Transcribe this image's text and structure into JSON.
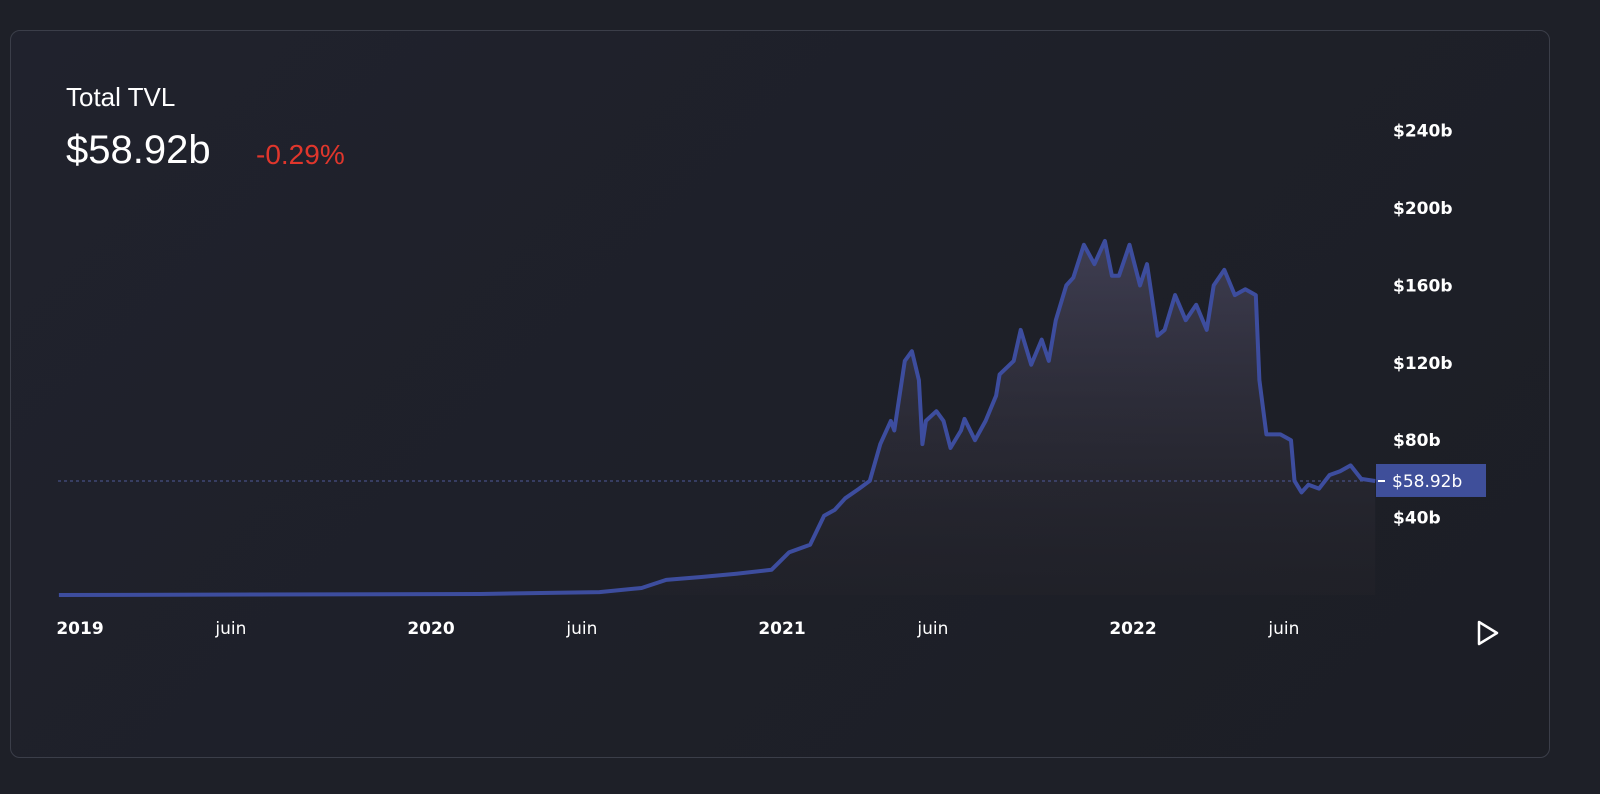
{
  "header": {
    "title": "Total TVL",
    "value": "$58.92b",
    "change": "-0.29%"
  },
  "colors": {
    "line": "#3d4d9e",
    "change_negative": "#e0362c",
    "current_label_bg": "#3f4f9a"
  },
  "play_icon": "play-icon",
  "chart_data": {
    "type": "area",
    "title": "Total TVL",
    "xlabel": "",
    "ylabel": "",
    "x_unit": "decimal year",
    "y_unit": "billion USD",
    "ylim": [
      0,
      240
    ],
    "xlim": [
      2018.94,
      2022.69
    ],
    "y_ticks": [
      {
        "value": 40,
        "label": "$40b"
      },
      {
        "value": 80,
        "label": "$80b"
      },
      {
        "value": 120,
        "label": "$120b"
      },
      {
        "value": 160,
        "label": "$160b"
      },
      {
        "value": 200,
        "label": "$200b"
      },
      {
        "value": 240,
        "label": "$240b"
      }
    ],
    "x_ticks": [
      {
        "value": 2019.0,
        "label": "2019",
        "year": true
      },
      {
        "value": 2019.43,
        "label": "juin",
        "year": false
      },
      {
        "value": 2020.0,
        "label": "2020",
        "year": true
      },
      {
        "value": 2020.43,
        "label": "juin",
        "year": false
      },
      {
        "value": 2021.0,
        "label": "2021",
        "year": true
      },
      {
        "value": 2021.43,
        "label": "juin",
        "year": false
      },
      {
        "value": 2022.0,
        "label": "2022",
        "year": true
      },
      {
        "value": 2022.43,
        "label": "juin",
        "year": false
      }
    ],
    "current": {
      "value": 58.92,
      "label": "$58.92b"
    },
    "grid": false,
    "series": [
      {
        "name": "Total TVL",
        "points": [
          [
            2018.94,
            0
          ],
          [
            2020.14,
            0.5
          ],
          [
            2020.48,
            1.5
          ],
          [
            2020.6,
            3.6
          ],
          [
            2020.67,
            7.8
          ],
          [
            2020.77,
            9.3
          ],
          [
            2020.87,
            11
          ],
          [
            2020.97,
            13
          ],
          [
            2021.02,
            22
          ],
          [
            2021.08,
            26
          ],
          [
            2021.12,
            41
          ],
          [
            2021.15,
            44
          ],
          [
            2021.18,
            50
          ],
          [
            2021.22,
            55
          ],
          [
            2021.25,
            59
          ],
          [
            2021.28,
            78
          ],
          [
            2021.31,
            90
          ],
          [
            2021.32,
            85
          ],
          [
            2021.35,
            121
          ],
          [
            2021.37,
            126
          ],
          [
            2021.39,
            111
          ],
          [
            2021.4,
            78
          ],
          [
            2021.41,
            90
          ],
          [
            2021.44,
            95
          ],
          [
            2021.46,
            90
          ],
          [
            2021.48,
            76
          ],
          [
            2021.51,
            85
          ],
          [
            2021.52,
            91
          ],
          [
            2021.55,
            80
          ],
          [
            2021.58,
            90
          ],
          [
            2021.61,
            103
          ],
          [
            2021.62,
            114
          ],
          [
            2021.66,
            121
          ],
          [
            2021.68,
            137
          ],
          [
            2021.71,
            119
          ],
          [
            2021.74,
            132
          ],
          [
            2021.76,
            121
          ],
          [
            2021.78,
            142
          ],
          [
            2021.81,
            160
          ],
          [
            2021.83,
            164
          ],
          [
            2021.86,
            181
          ],
          [
            2021.89,
            171
          ],
          [
            2021.92,
            183
          ],
          [
            2021.94,
            165
          ],
          [
            2021.96,
            165
          ],
          [
            2021.99,
            181
          ],
          [
            2022.02,
            160
          ],
          [
            2022.04,
            171
          ],
          [
            2022.07,
            134
          ],
          [
            2022.09,
            137
          ],
          [
            2022.12,
            155
          ],
          [
            2022.15,
            142
          ],
          [
            2022.18,
            150
          ],
          [
            2022.21,
            137
          ],
          [
            2022.23,
            160
          ],
          [
            2022.26,
            168
          ],
          [
            2022.29,
            155
          ],
          [
            2022.32,
            158
          ],
          [
            2022.35,
            155
          ],
          [
            2022.36,
            111
          ],
          [
            2022.38,
            83
          ],
          [
            2022.42,
            83
          ],
          [
            2022.45,
            80
          ],
          [
            2022.46,
            59
          ],
          [
            2022.48,
            53
          ],
          [
            2022.5,
            57
          ],
          [
            2022.53,
            55
          ],
          [
            2022.56,
            62
          ],
          [
            2022.59,
            64
          ],
          [
            2022.62,
            67
          ],
          [
            2022.65,
            60
          ],
          [
            2022.69,
            58.92
          ]
        ]
      }
    ]
  }
}
